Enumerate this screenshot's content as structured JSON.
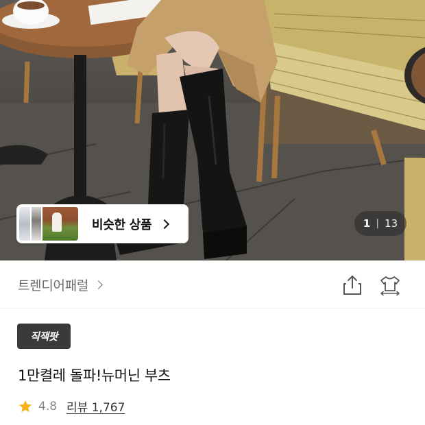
{
  "gallery": {
    "similar_products_label": "비슷한 상품",
    "current_page": "1",
    "page_separator": "|",
    "total_pages": "13"
  },
  "brand": {
    "name": "트렌디어패럴"
  },
  "product": {
    "badge_label": "직잭팟",
    "title": "1만켤레 돌파!뉴머닌 부츠",
    "rating": "4.8",
    "review_label": "리뷰 1,767"
  },
  "colors": {
    "star": "#f5b31b",
    "badge_bg": "#3a3a3a",
    "icon_gray": "#555555"
  },
  "icons": {
    "share": "share-icon",
    "size": "size-guide-icon",
    "star": "star-icon"
  }
}
